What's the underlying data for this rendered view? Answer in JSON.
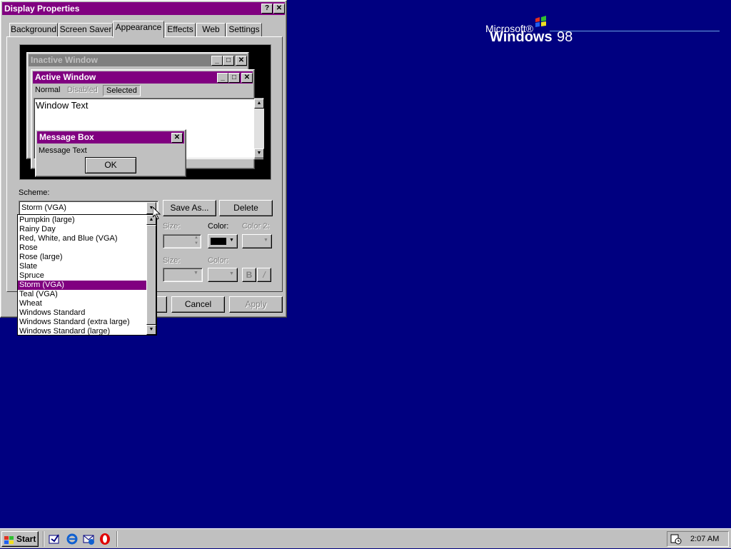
{
  "dialog": {
    "title": "Display Properties",
    "help_btn": "?",
    "close_btn": "✕",
    "tabs": [
      {
        "label": "Background"
      },
      {
        "label": "Screen Saver"
      },
      {
        "label": "Appearance"
      },
      {
        "label": "Effects"
      },
      {
        "label": "Web"
      },
      {
        "label": "Settings"
      }
    ],
    "active_tab": "Appearance"
  },
  "preview": {
    "inactive_title": "Inactive Window",
    "active_title": "Active Window",
    "menu": {
      "normal": "Normal",
      "disabled": "Disabled",
      "selected": "Selected"
    },
    "window_text": "Window Text",
    "message_box_title": "Message Box",
    "message_text": "Message Text",
    "ok": "OK"
  },
  "scheme": {
    "label": "Scheme:",
    "value": "Storm (VGA)",
    "save_as": "Save As...",
    "delete": "Delete",
    "options": [
      "Pumpkin (large)",
      "Rainy Day",
      "Red, White, and Blue (VGA)",
      "Rose",
      "Rose (large)",
      "Slate",
      "Spruce",
      "Storm (VGA)",
      "Teal (VGA)",
      "Wheat",
      "Windows Standard",
      "Windows Standard (extra large)",
      "Windows Standard (large)"
    ],
    "selected_option": "Storm (VGA)"
  },
  "item_settings": {
    "size_label": "Size:",
    "color_label": "Color:",
    "color2_label": "Color 2:",
    "font_size_label": "Size:",
    "font_color_label": "Color:",
    "bold": "B",
    "italic": "/",
    "color_value": "#000000"
  },
  "footer": {
    "cancel": "Cancel",
    "apply": "Apply"
  },
  "desktop": {
    "logo_microsoft": "Microsoft®",
    "logo_windows": "Windows",
    "logo_version": "98"
  },
  "taskbar": {
    "start": "Start",
    "clock": "2:07 AM"
  },
  "colors": {
    "desktop": "#000080",
    "accent": "#800080",
    "titlebar": "#000080",
    "inactive": "#808080"
  }
}
